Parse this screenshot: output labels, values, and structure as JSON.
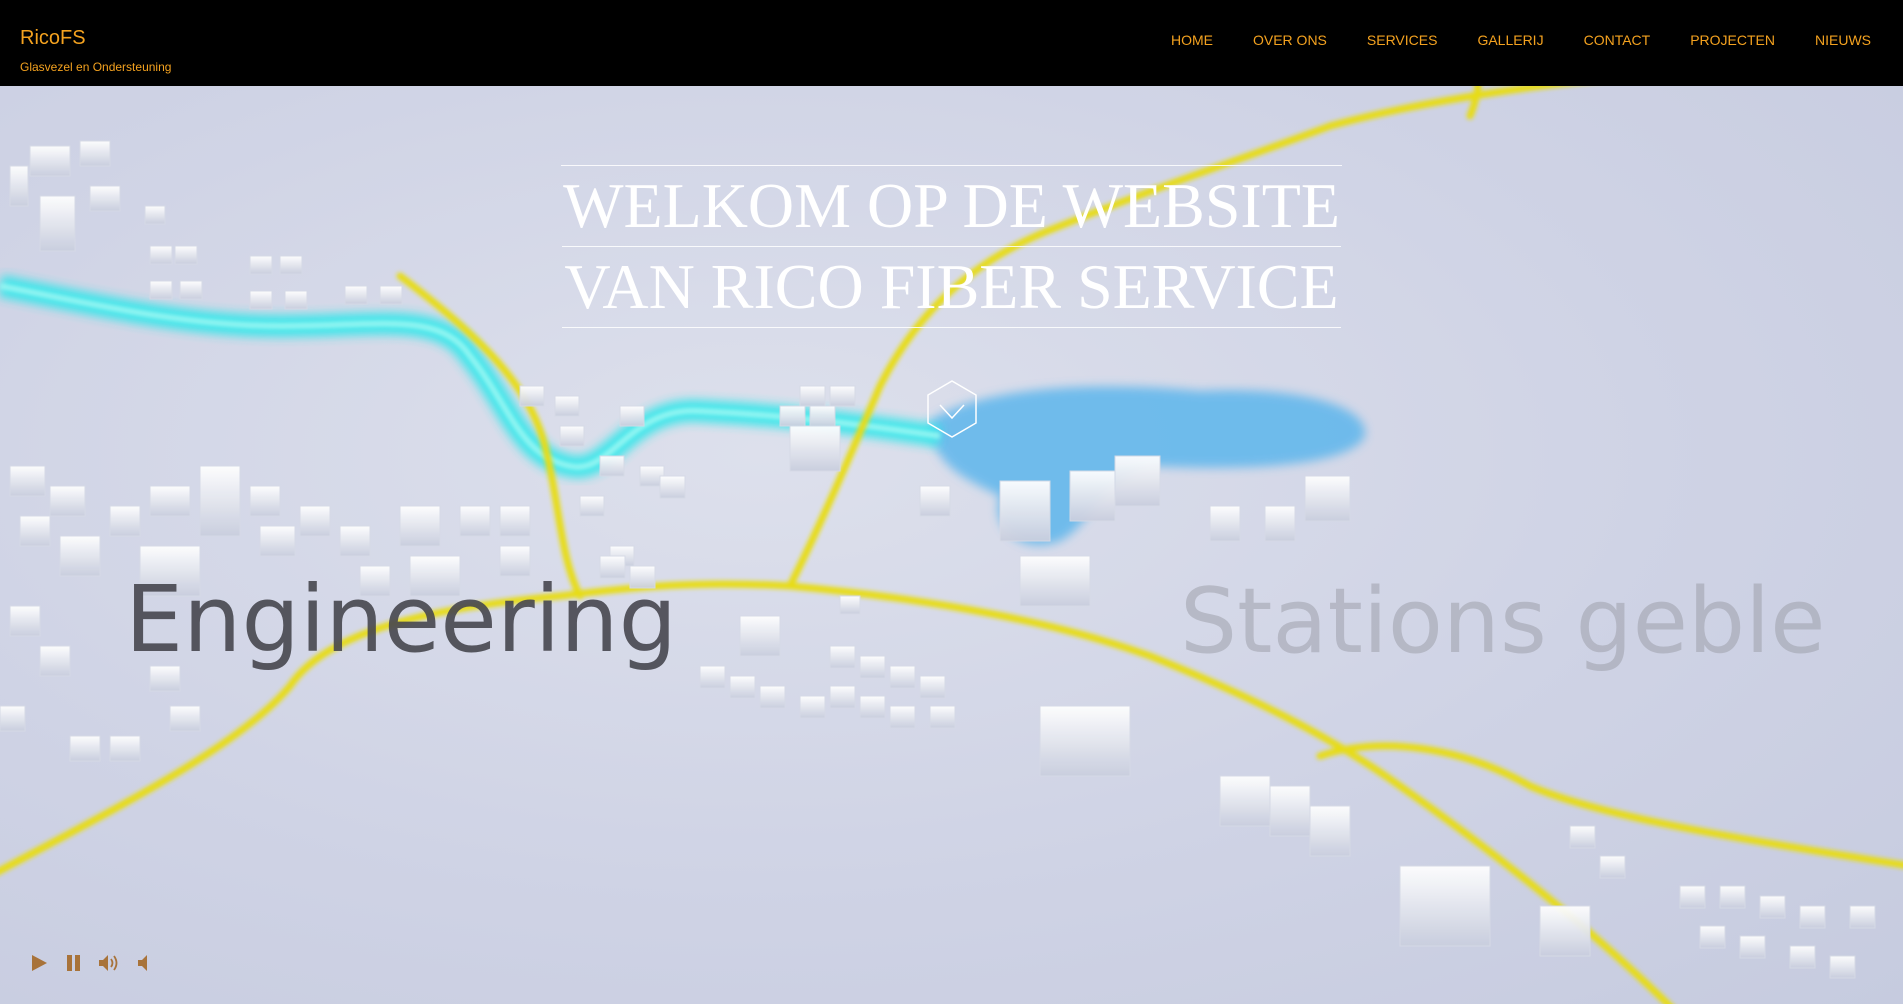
{
  "brand": {
    "name": "RicoFS",
    "tagline": "Glasvezel en Ondersteuning"
  },
  "nav": {
    "items": [
      "HOME",
      "OVER ONS",
      "SERVICES",
      "GALLERIJ",
      "CONTACT",
      "PROJECTEN",
      "NIEUWS"
    ]
  },
  "hero": {
    "headline_line1": "WELKOM OP DE WEBSITE",
    "headline_line2": "VAN RICO FIBER SERVICE",
    "video_text_left": "Engineering",
    "video_text_right": "Stations geble",
    "scroll_icon": "chevron-down-hexagon-icon"
  },
  "video_controls": [
    "play-icon",
    "pause-icon",
    "volume-up-icon",
    "volume-mute-icon"
  ],
  "colors": {
    "header_bg": "#000000",
    "accent": "#f4a21f",
    "road": "#e7dc18",
    "fiber": "#2fe0e6",
    "water_blue": "#58b8ea",
    "control": "#a8733a"
  }
}
